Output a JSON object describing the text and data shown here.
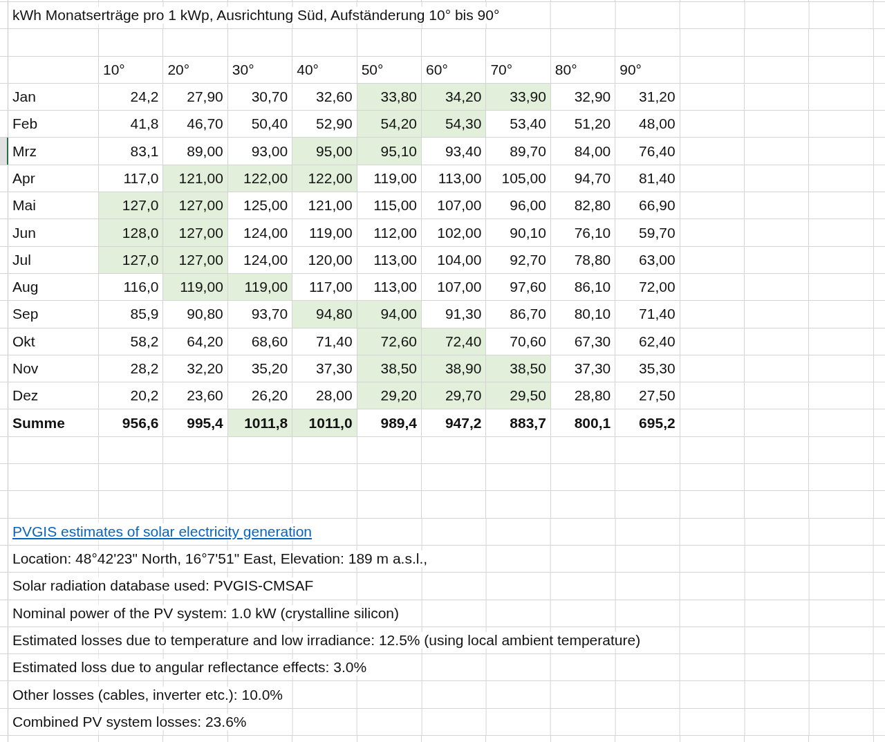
{
  "title": "kWh Monatserträge pro 1 kWp, Ausrichtung Süd, Aufständerung 10° bis 90°",
  "table": {
    "columns": [
      "10°",
      "20°",
      "30°",
      "40°",
      "50°",
      "60°",
      "70°",
      "80°",
      "90°"
    ],
    "rows": [
      {
        "label": "Jan",
        "kind": "month",
        "selected": false,
        "cells": [
          {
            "value": "24,2",
            "highlighted": false
          },
          {
            "value": "27,90",
            "highlighted": false
          },
          {
            "value": "30,70",
            "highlighted": false
          },
          {
            "value": "32,60",
            "highlighted": false
          },
          {
            "value": "33,80",
            "highlighted": true
          },
          {
            "value": "34,20",
            "highlighted": true
          },
          {
            "value": "33,90",
            "highlighted": true
          },
          {
            "value": "32,90",
            "highlighted": false
          },
          {
            "value": "31,20",
            "highlighted": false
          }
        ]
      },
      {
        "label": "Feb",
        "kind": "month",
        "selected": false,
        "cells": [
          {
            "value": "41,8",
            "highlighted": false
          },
          {
            "value": "46,70",
            "highlighted": false
          },
          {
            "value": "50,40",
            "highlighted": false
          },
          {
            "value": "52,90",
            "highlighted": false
          },
          {
            "value": "54,20",
            "highlighted": true
          },
          {
            "value": "54,30",
            "highlighted": true
          },
          {
            "value": "53,40",
            "highlighted": false
          },
          {
            "value": "51,20",
            "highlighted": false
          },
          {
            "value": "48,00",
            "highlighted": false
          }
        ]
      },
      {
        "label": "Mrz",
        "kind": "month",
        "selected": true,
        "cells": [
          {
            "value": "83,1",
            "highlighted": false
          },
          {
            "value": "89,00",
            "highlighted": false
          },
          {
            "value": "93,00",
            "highlighted": false
          },
          {
            "value": "95,00",
            "highlighted": true
          },
          {
            "value": "95,10",
            "highlighted": true
          },
          {
            "value": "93,40",
            "highlighted": false
          },
          {
            "value": "89,70",
            "highlighted": false
          },
          {
            "value": "84,00",
            "highlighted": false
          },
          {
            "value": "76,40",
            "highlighted": false
          }
        ]
      },
      {
        "label": "Apr",
        "kind": "month",
        "selected": false,
        "cells": [
          {
            "value": "117,0",
            "highlighted": false
          },
          {
            "value": "121,00",
            "highlighted": true
          },
          {
            "value": "122,00",
            "highlighted": true
          },
          {
            "value": "122,00",
            "highlighted": true
          },
          {
            "value": "119,00",
            "highlighted": false
          },
          {
            "value": "113,00",
            "highlighted": false
          },
          {
            "value": "105,00",
            "highlighted": false
          },
          {
            "value": "94,70",
            "highlighted": false
          },
          {
            "value": "81,40",
            "highlighted": false
          }
        ]
      },
      {
        "label": "Mai",
        "kind": "month",
        "selected": false,
        "cells": [
          {
            "value": "127,0",
            "highlighted": true
          },
          {
            "value": "127,00",
            "highlighted": true
          },
          {
            "value": "125,00",
            "highlighted": false
          },
          {
            "value": "121,00",
            "highlighted": false
          },
          {
            "value": "115,00",
            "highlighted": false
          },
          {
            "value": "107,00",
            "highlighted": false
          },
          {
            "value": "96,00",
            "highlighted": false
          },
          {
            "value": "82,80",
            "highlighted": false
          },
          {
            "value": "66,90",
            "highlighted": false
          }
        ]
      },
      {
        "label": "Jun",
        "kind": "month",
        "selected": false,
        "cells": [
          {
            "value": "128,0",
            "highlighted": true
          },
          {
            "value": "127,00",
            "highlighted": true
          },
          {
            "value": "124,00",
            "highlighted": false
          },
          {
            "value": "119,00",
            "highlighted": false
          },
          {
            "value": "112,00",
            "highlighted": false
          },
          {
            "value": "102,00",
            "highlighted": false
          },
          {
            "value": "90,10",
            "highlighted": false
          },
          {
            "value": "76,10",
            "highlighted": false
          },
          {
            "value": "59,70",
            "highlighted": false
          }
        ]
      },
      {
        "label": "Jul",
        "kind": "month",
        "selected": false,
        "cells": [
          {
            "value": "127,0",
            "highlighted": true
          },
          {
            "value": "127,00",
            "highlighted": true
          },
          {
            "value": "124,00",
            "highlighted": false
          },
          {
            "value": "120,00",
            "highlighted": false
          },
          {
            "value": "113,00",
            "highlighted": false
          },
          {
            "value": "104,00",
            "highlighted": false
          },
          {
            "value": "92,70",
            "highlighted": false
          },
          {
            "value": "78,80",
            "highlighted": false
          },
          {
            "value": "63,00",
            "highlighted": false
          }
        ]
      },
      {
        "label": "Aug",
        "kind": "month",
        "selected": false,
        "cells": [
          {
            "value": "116,0",
            "highlighted": false
          },
          {
            "value": "119,00",
            "highlighted": true
          },
          {
            "value": "119,00",
            "highlighted": true
          },
          {
            "value": "117,00",
            "highlighted": false
          },
          {
            "value": "113,00",
            "highlighted": false
          },
          {
            "value": "107,00",
            "highlighted": false
          },
          {
            "value": "97,60",
            "highlighted": false
          },
          {
            "value": "86,10",
            "highlighted": false
          },
          {
            "value": "72,00",
            "highlighted": false
          }
        ]
      },
      {
        "label": "Sep",
        "kind": "month",
        "selected": false,
        "cells": [
          {
            "value": "85,9",
            "highlighted": false
          },
          {
            "value": "90,80",
            "highlighted": false
          },
          {
            "value": "93,70",
            "highlighted": false
          },
          {
            "value": "94,80",
            "highlighted": true
          },
          {
            "value": "94,00",
            "highlighted": true
          },
          {
            "value": "91,30",
            "highlighted": false
          },
          {
            "value": "86,70",
            "highlighted": false
          },
          {
            "value": "80,10",
            "highlighted": false
          },
          {
            "value": "71,40",
            "highlighted": false
          }
        ]
      },
      {
        "label": "Okt",
        "kind": "month",
        "selected": false,
        "cells": [
          {
            "value": "58,2",
            "highlighted": false
          },
          {
            "value": "64,20",
            "highlighted": false
          },
          {
            "value": "68,60",
            "highlighted": false
          },
          {
            "value": "71,40",
            "highlighted": false
          },
          {
            "value": "72,60",
            "highlighted": true
          },
          {
            "value": "72,40",
            "highlighted": true
          },
          {
            "value": "70,60",
            "highlighted": false
          },
          {
            "value": "67,30",
            "highlighted": false
          },
          {
            "value": "62,40",
            "highlighted": false
          }
        ]
      },
      {
        "label": "Nov",
        "kind": "month",
        "selected": false,
        "cells": [
          {
            "value": "28,2",
            "highlighted": false
          },
          {
            "value": "32,20",
            "highlighted": false
          },
          {
            "value": "35,20",
            "highlighted": false
          },
          {
            "value": "37,30",
            "highlighted": false
          },
          {
            "value": "38,50",
            "highlighted": true
          },
          {
            "value": "38,90",
            "highlighted": true
          },
          {
            "value": "38,50",
            "highlighted": true
          },
          {
            "value": "37,30",
            "highlighted": false
          },
          {
            "value": "35,30",
            "highlighted": false
          }
        ]
      },
      {
        "label": "Dez",
        "kind": "month",
        "selected": false,
        "cells": [
          {
            "value": "20,2",
            "highlighted": false
          },
          {
            "value": "23,60",
            "highlighted": false
          },
          {
            "value": "26,20",
            "highlighted": false
          },
          {
            "value": "28,00",
            "highlighted": false
          },
          {
            "value": "29,20",
            "highlighted": true
          },
          {
            "value": "29,70",
            "highlighted": true
          },
          {
            "value": "29,50",
            "highlighted": true
          },
          {
            "value": "28,80",
            "highlighted": false
          },
          {
            "value": "27,50",
            "highlighted": false
          }
        ]
      },
      {
        "label": "Summe",
        "kind": "total",
        "selected": false,
        "cells": [
          {
            "value": "956,6",
            "highlighted": false
          },
          {
            "value": "995,4",
            "highlighted": false
          },
          {
            "value": "1011,8",
            "highlighted": true
          },
          {
            "value": "1011,0",
            "highlighted": true
          },
          {
            "value": "989,4",
            "highlighted": false
          },
          {
            "value": "947,2",
            "highlighted": false
          },
          {
            "value": "883,7",
            "highlighted": false
          },
          {
            "value": "800,1",
            "highlighted": false
          },
          {
            "value": "695,2",
            "highlighted": false
          }
        ]
      }
    ]
  },
  "source_link": "PVGIS estimates of solar electricity generation",
  "notes": [
    "Location: 48°42'23\" North, 16°7'51\" East, Elevation: 189 m a.s.l.,",
    "Solar radiation database used: PVGIS-CMSAF",
    "Nominal power of the PV system: 1.0 kW (crystalline silicon)",
    "Estimated losses due to temperature and low irradiance: 12.5% (using local ambient temperature)",
    "Estimated loss due to angular reflectance effects: 3.0%",
    "Other losses (cables, inverter etc.): 10.0%",
    "Combined PV system losses: 23.6%"
  ]
}
